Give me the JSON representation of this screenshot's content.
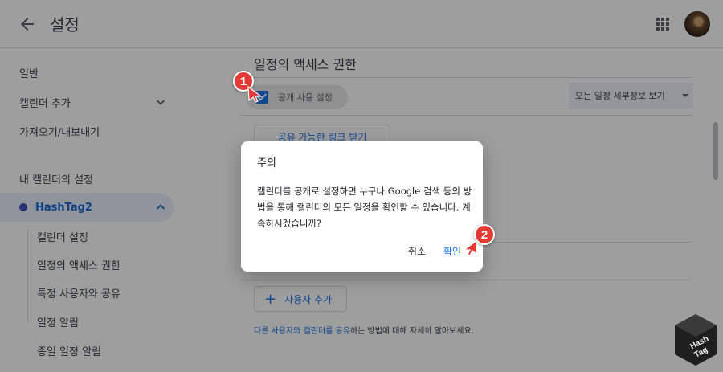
{
  "header": {
    "title": "설정"
  },
  "sidebar": {
    "items": [
      {
        "label": "일반"
      },
      {
        "label": "캘린더 추가"
      },
      {
        "label": "가져오기/내보내기"
      }
    ],
    "section_heading": "내 캘린더의 설정",
    "calendar": {
      "label": "HashTag2",
      "dot_color": "#3f51b5"
    },
    "sub_items": [
      {
        "label": "캘린더 설정"
      },
      {
        "label": "일정의 액세스 권한"
      },
      {
        "label": "특정 사용자와 공유"
      },
      {
        "label": "일정 알림"
      },
      {
        "label": "종일 일정 알림"
      }
    ]
  },
  "main": {
    "title": "일정의 액세스 권한",
    "public_checkbox": {
      "label": "공개 사용 설정",
      "checked": true
    },
    "detail_select": {
      "value": "모든 일정 세부정보 보기"
    },
    "link_button": "공유 가능한 링크 받기",
    "add_user_button": "사용자 추가",
    "help": {
      "link1": "다른 사용자와 캘린더를 공유",
      "rest": "하는 방법에 대해 자세히 알아보세요."
    }
  },
  "dialog": {
    "title": "주의",
    "body": "캘린더를 공개로 설정하면 누구나 Google 검색 등의 방법을 통해 캘린더의 모든 일정을 확인할 수 있습니다. 계속하시겠습니까?",
    "cancel": "취소",
    "ok": "확인"
  },
  "annotations": [
    {
      "label": "1",
      "color": "#e53935"
    },
    {
      "label": "2",
      "color": "#e53935"
    }
  ],
  "watermark": {
    "line1": "Hash",
    "line2": "Tag"
  },
  "colors": {
    "accent": "#1a73e8",
    "active_bg": "#e8f0fe"
  }
}
